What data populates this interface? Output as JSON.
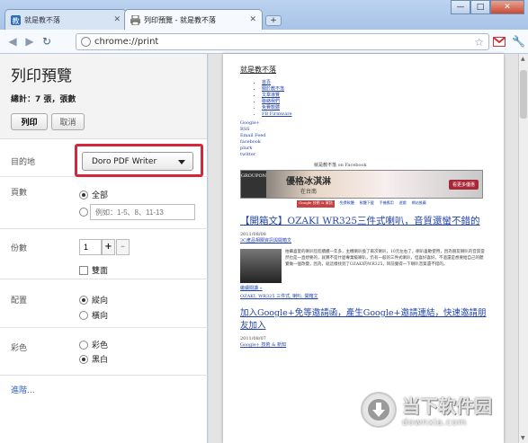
{
  "browser": {
    "tabs": [
      {
        "title": "就是教不落",
        "active": false
      },
      {
        "title": "列印預覽 - 就是教不落",
        "active": true
      }
    ],
    "url": "chrome://print",
    "window_buttons": [
      "—",
      "□",
      "✕"
    ]
  },
  "print_panel": {
    "title": "列印預覽",
    "summary": "總計：7 張，張數",
    "print_button": "列印",
    "cancel_button": "取消",
    "destination": {
      "label": "目的地",
      "value": "Doro PDF Writer"
    },
    "pages": {
      "label": "頁數",
      "all": "全部",
      "range_placeholder": "例如：1-5、8、11-13",
      "selected": "all"
    },
    "copies": {
      "label": "份數",
      "value": "1",
      "plus": "+",
      "minus": "–",
      "collate": "雙面"
    },
    "layout": {
      "label": "配置",
      "portrait": "縱向",
      "landscape": "橫向",
      "selected": "portrait"
    },
    "color": {
      "label": "彩色",
      "color": "彩色",
      "bw": "黑白",
      "selected": "bw"
    },
    "more": "進階..."
  },
  "preview": {
    "site_title": "就是教不落",
    "nav": [
      "首頁",
      "關於教不落",
      "文章導覽",
      "聯絡我們",
      "免費軟體",
      "FB Firmware"
    ],
    "links": [
      "Google+",
      "RSS",
      "Email Feed",
      "facebook",
      "plurk",
      "twitter"
    ],
    "fb_text": "就是教不落 on Facebook",
    "banner": {
      "logo": "GROUPON",
      "headline": "優格冰淇淋",
      "sub": "在台南",
      "cta": "看更多優惠"
    },
    "menu": [
      "Google 技術 & 資訊",
      "免費軟體",
      "軟體下載",
      "手機應用",
      "遊戲",
      "網站推薦"
    ],
    "post1": {
      "title": "【開箱文】OZAKI WR325三件式喇叭，音質還蠻不錯的",
      "date": "2011/08/08",
      "meta": "3C產品相關資訊與開箱文",
      "excerpt": "拍攝喜愛的喇叭陸陸續續一年多，主機喇叭換了兩次喇叭，10元左右了，喇叭喜歡使用，因為朋友喇叭的音質當然也是一直想要的，就算不是什麼專業級喇叭，仍有一般的三件式喇叭，但喜好喜好，不過還是想要給自己的聽覺做一個改變，因為，就這樣找到了OZAKI的WR325，目前覺得一下喇叭音質還不錯的。",
      "read_more": "繼續閱讀 »",
      "tags": "OZAKI, WR325 三件式, 喇叭, 開箱文"
    },
    "post2": {
      "title": "加入Google+免等邀請函，產生Google+邀請連結，快速邀請朋友加入",
      "date": "2011/08/07",
      "meta": "Google+ 技術 & 新知"
    }
  },
  "watermark": {
    "cn": "当下软件园",
    "en": "downxia.com"
  }
}
